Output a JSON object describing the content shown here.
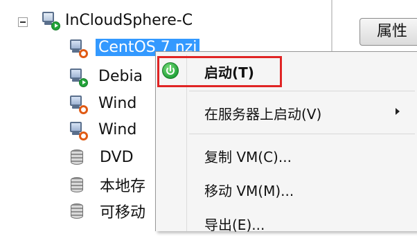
{
  "tree": {
    "root": {
      "label": "InCloudSphere-C"
    },
    "items": [
      {
        "label": "CentOS 7 nzj",
        "kind": "vm",
        "state": "stopped",
        "selected": true
      },
      {
        "label": "Debia",
        "kind": "vm",
        "state": "running"
      },
      {
        "label": "Wind",
        "kind": "vm",
        "state": "stopped"
      },
      {
        "label": "Wind",
        "kind": "vm",
        "state": "stopped"
      },
      {
        "label": "DVD",
        "kind": "storage"
      },
      {
        "label": "本地存",
        "kind": "storage"
      },
      {
        "label": "可移动",
        "kind": "storage"
      }
    ]
  },
  "properties_button": {
    "label": "属性"
  },
  "context_menu": {
    "items": [
      {
        "label": "启动(T)",
        "icon": "power-on-icon",
        "bold": true,
        "highlighted": true
      },
      {
        "label": "在服务器上启动(V)",
        "submenu": true
      },
      {
        "label": "复制 VM(C)..."
      },
      {
        "label": "移动 VM(M)..."
      },
      {
        "label": "导出(E)..."
      }
    ]
  },
  "colors": {
    "selection": "#3399ff",
    "highlight_border": "#e02424",
    "running": "#23a33a",
    "stopped": "#e05a14"
  }
}
